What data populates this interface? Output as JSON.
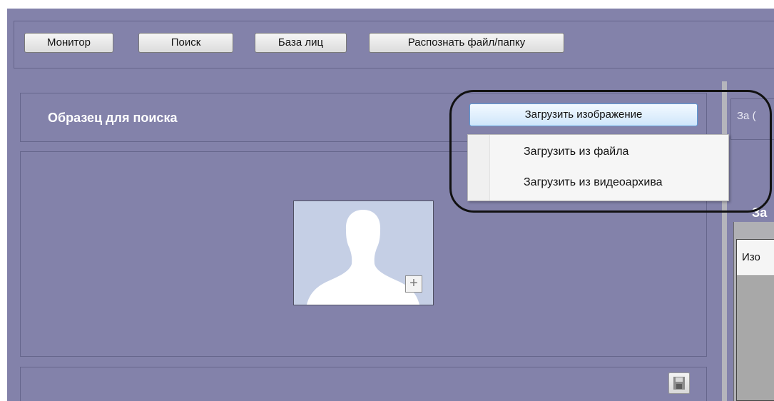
{
  "toolbar": {
    "buttons": [
      {
        "label": "Монитор"
      },
      {
        "label": "Поиск"
      },
      {
        "label": "База лиц"
      },
      {
        "label": "Распознать файл/папку"
      }
    ]
  },
  "sample": {
    "title": "Образец для поиска",
    "load_button": "Загрузить изображение",
    "add_icon": "+",
    "menu": [
      {
        "label": "Загрузить из файла"
      },
      {
        "label": "Загрузить из видеоархива"
      }
    ]
  },
  "right": {
    "top_text": "За (",
    "bold_text": "За",
    "table_header": "Изо"
  },
  "icons": {
    "placeholder": "person-silhouette-icon",
    "add": "plus-icon",
    "save": "save-icon"
  },
  "colors": {
    "panel_bg": "#8382aa",
    "button_highlight": "#cfe6fb",
    "placeholder_bg": "#c5cfe5"
  }
}
